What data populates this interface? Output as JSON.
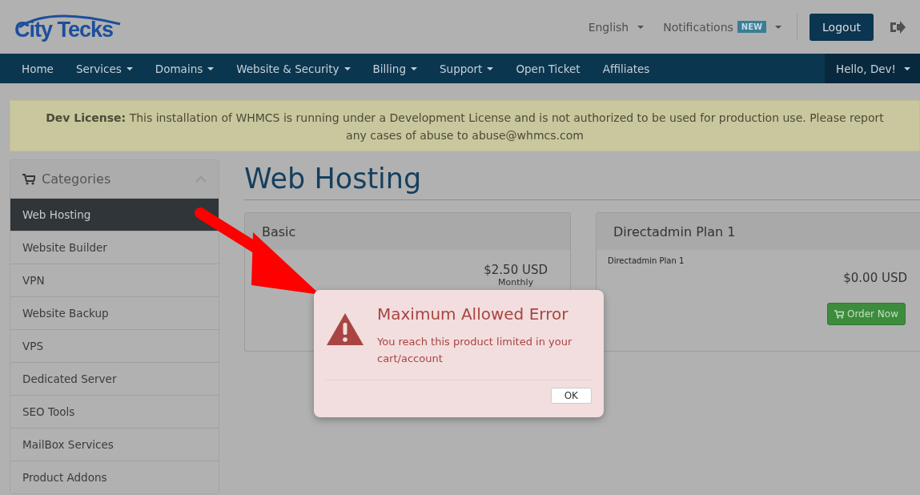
{
  "header": {
    "logo": "City Tecks",
    "language": "English",
    "notifications": {
      "label": "Notifications",
      "badge": "NEW"
    },
    "logout": "Logout"
  },
  "nav": {
    "items": [
      {
        "label": "Home",
        "dropdown": false
      },
      {
        "label": "Services",
        "dropdown": true
      },
      {
        "label": "Domains",
        "dropdown": true
      },
      {
        "label": "Website & Security",
        "dropdown": true
      },
      {
        "label": "Billing",
        "dropdown": true
      },
      {
        "label": "Support",
        "dropdown": true
      },
      {
        "label": "Open Ticket",
        "dropdown": false
      },
      {
        "label": "Affiliates",
        "dropdown": false
      }
    ],
    "user": "Hello, Dev!"
  },
  "banner": "**Dev License:** This installation of WHMCS is running under a Development License and is not authorized to be used for production use. Please report any cases of abuse to abuse@whmcs.com",
  "sidebar": {
    "title": "Categories",
    "expanded": true,
    "items": [
      {
        "label": "Web Hosting",
        "selected": true
      },
      {
        "label": "Website Builder",
        "selected": false
      },
      {
        "label": "VPN",
        "selected": false
      },
      {
        "label": "Website Backup",
        "selected": false
      },
      {
        "label": "VPS",
        "selected": false
      },
      {
        "label": "Dedicated Server",
        "selected": false
      },
      {
        "label": "SEO Tools",
        "selected": false
      },
      {
        "label": "MailBox Services",
        "selected": false
      },
      {
        "label": "Product Addons",
        "selected": false
      }
    ]
  },
  "page_title": "Web Hosting",
  "products": [
    {
      "name": "Basic",
      "price": "$2.50 USD",
      "cycle": "Monthly"
    },
    {
      "name": "Directadmin Plan 1",
      "description": "Directadmin Plan 1",
      "price": "$0.00 USD",
      "button": "Order Now"
    }
  ],
  "dialog": {
    "title": "Maximum Allowed Error",
    "message": "You reach this product limited in your cart/account",
    "button": "OK"
  }
}
